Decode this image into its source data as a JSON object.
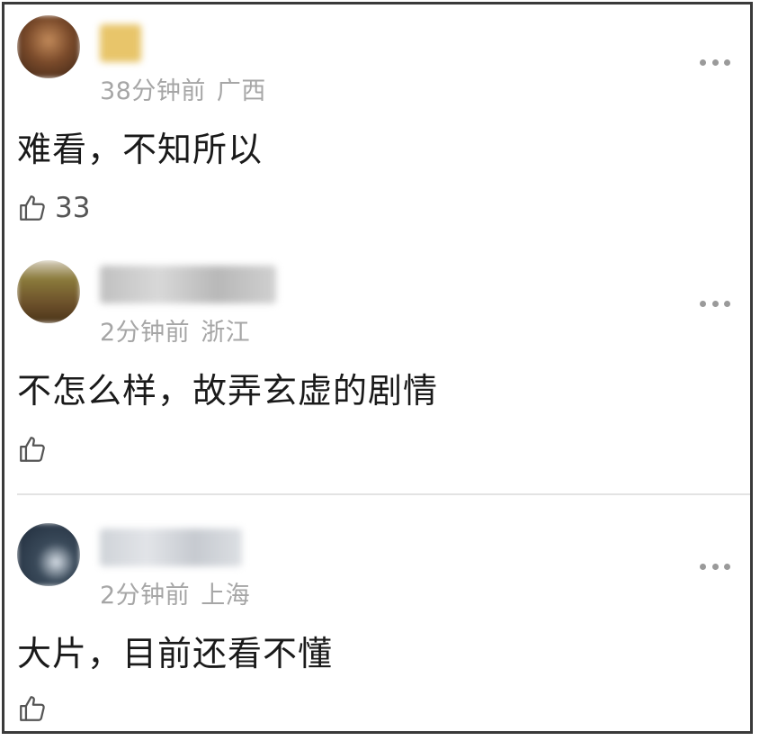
{
  "comments": [
    {
      "time": "38分钟前",
      "location": "广西",
      "text": "难看，不知所以",
      "likes": "33",
      "avatar_colors": [
        "#7a4a2a",
        "#c28a5a",
        "#3b2416"
      ],
      "name_color": "#e8c56a"
    },
    {
      "time": "2分钟前",
      "location": "浙江",
      "text": "不怎么样，故弄玄虚的剧情",
      "likes": "",
      "avatar_colors": [
        "#6b4f2a",
        "#8a7a3a",
        "#d8d0c0"
      ],
      "name_color": "#c9c9c9"
    },
    {
      "time": "2分钟前",
      "location": "上海",
      "text": "大片，目前还看不懂",
      "likes": "",
      "avatar_colors": [
        "#1e2a3a",
        "#3a4a5a",
        "#d8e0e8"
      ],
      "name_color": "#cfd3d8"
    }
  ]
}
